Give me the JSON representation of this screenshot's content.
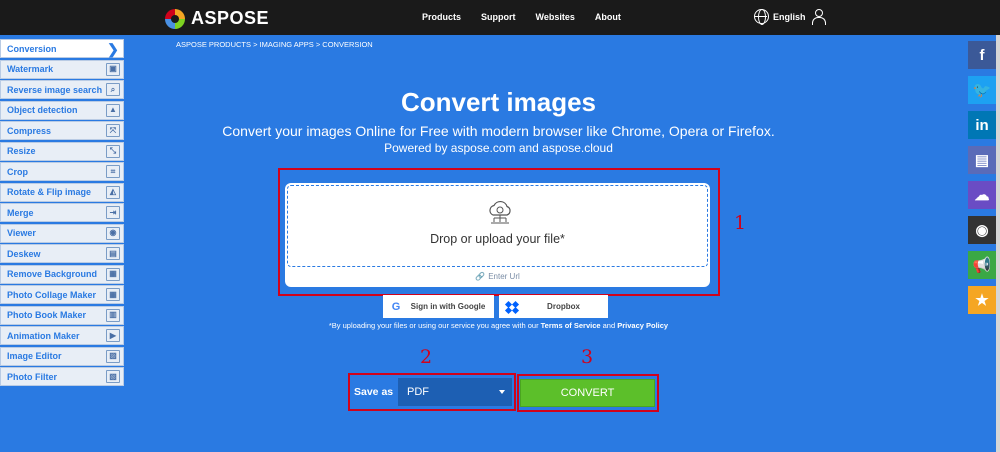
{
  "header": {
    "logo_text": "ASPOSE",
    "nav": [
      "Products",
      "Support",
      "Websites",
      "About"
    ],
    "language": "English"
  },
  "sidebar": {
    "items": [
      {
        "label": "Conversion",
        "icon": "chevron-right-icon",
        "glyph": "❯"
      },
      {
        "label": "Watermark",
        "icon": "watermark-icon",
        "glyph": "▣"
      },
      {
        "label": "Reverse image search",
        "icon": "image-search-icon",
        "glyph": "⌕"
      },
      {
        "label": "Object detection",
        "icon": "object-detection-icon",
        "glyph": "▲"
      },
      {
        "label": "Compress",
        "icon": "compress-icon",
        "glyph": "⤧"
      },
      {
        "label": "Resize",
        "icon": "resize-icon",
        "glyph": "⤡"
      },
      {
        "label": "Crop",
        "icon": "crop-icon",
        "glyph": "⌗"
      },
      {
        "label": "Rotate & Flip image",
        "icon": "rotate-flip-icon",
        "glyph": "◭"
      },
      {
        "label": "Merge",
        "icon": "merge-icon",
        "glyph": "⇥"
      },
      {
        "label": "Viewer",
        "icon": "eye-icon",
        "glyph": "◉"
      },
      {
        "label": "Deskew",
        "icon": "deskew-icon",
        "glyph": "▤"
      },
      {
        "label": "Remove Background",
        "icon": "remove-background-icon",
        "glyph": "▦"
      },
      {
        "label": "Photo Collage Maker",
        "icon": "collage-icon",
        "glyph": "▦"
      },
      {
        "label": "Photo Book Maker",
        "icon": "photo-book-icon",
        "glyph": "▥"
      },
      {
        "label": "Animation Maker",
        "icon": "animation-icon",
        "glyph": "▶"
      },
      {
        "label": "Image Editor",
        "icon": "image-editor-icon",
        "glyph": "▨"
      },
      {
        "label": "Photo Filter",
        "icon": "photo-filter-icon",
        "glyph": "▧"
      }
    ]
  },
  "breadcrumb": "ASPOSE PRODUCTS  >  IMAGING APPS  >  CONVERSION",
  "main": {
    "title": "Convert images",
    "subtitle": "Convert your images Online for Free with modern browser like Chrome, Opera or Firefox.",
    "powered": "Powered by aspose.com and aspose.cloud",
    "drop_text": "Drop or upload your file*",
    "enter_url": "Enter Url",
    "google_label": "Sign in with Google",
    "dropbox_label": "Dropbox",
    "terms_prefix": "*By uploading your files or using our service you agree with our ",
    "terms_link": "Terms of Service",
    "terms_and": " and ",
    "privacy_link": "Privacy Policy",
    "save_as_label": "Save as",
    "format_value": "PDF",
    "convert_label": "CONVERT"
  },
  "annotations": [
    "1",
    "2",
    "3"
  ],
  "social": [
    {
      "icon": "facebook-icon",
      "glyph": "f",
      "color": "#3b5998"
    },
    {
      "icon": "twitter-icon",
      "glyph": "🐦",
      "color": "#1da1f2"
    },
    {
      "icon": "linkedin-icon",
      "glyph": "in",
      "color": "#0077b5"
    },
    {
      "icon": "document-icon",
      "glyph": "▤",
      "color": "#5a6bb8"
    },
    {
      "icon": "cloud-icon",
      "glyph": "☁",
      "color": "#6a4cc4"
    },
    {
      "icon": "github-icon",
      "glyph": "◉",
      "color": "#333333"
    },
    {
      "icon": "megaphone-icon",
      "glyph": "📢",
      "color": "#3aa845"
    },
    {
      "icon": "star-icon",
      "glyph": "★",
      "color": "#f5a623"
    }
  ],
  "colors": {
    "background": "#2a7ae2",
    "header": "#1a1a1a",
    "convert": "#5cbf2a",
    "annotation": "#d0021b"
  }
}
